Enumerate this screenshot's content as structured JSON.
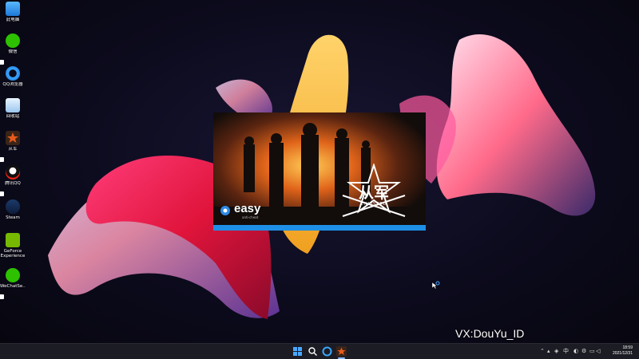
{
  "desktop_icons": [
    {
      "label": "此电脑",
      "icon": "computer-icon"
    },
    {
      "label": "微信",
      "icon": "wechat-icon"
    },
    {
      "label": "QQ浏览器",
      "icon": "qq-browser-icon"
    },
    {
      "label": "回收站",
      "icon": "recycle-bin-icon"
    },
    {
      "label": "从军",
      "icon": "enlisted-icon"
    },
    {
      "label": "腾讯QQ",
      "icon": "qq-icon"
    },
    {
      "label": "Steam",
      "icon": "steam-icon"
    },
    {
      "label": "GeForce Experience",
      "icon": "geforce-icon"
    },
    {
      "label": "WeChatSe...",
      "icon": "wechat-setup-icon"
    }
  ],
  "splash": {
    "brand": "easy",
    "brand_sub": "anti-cheat",
    "game_title": "从军",
    "game_subtitle": "ENLISTED"
  },
  "watermark": "VX:DouYu_ID",
  "taskbar": {
    "apps": [
      "windows-start-icon",
      "search-icon",
      "qq-browser-icon",
      "enlisted-icon"
    ],
    "tray": {
      "ime": "中",
      "time": "18:59",
      "date": "2021/12/31"
    }
  },
  "colors": {
    "accent": "#1e8fe6",
    "taskbar": "#1c1c24"
  }
}
